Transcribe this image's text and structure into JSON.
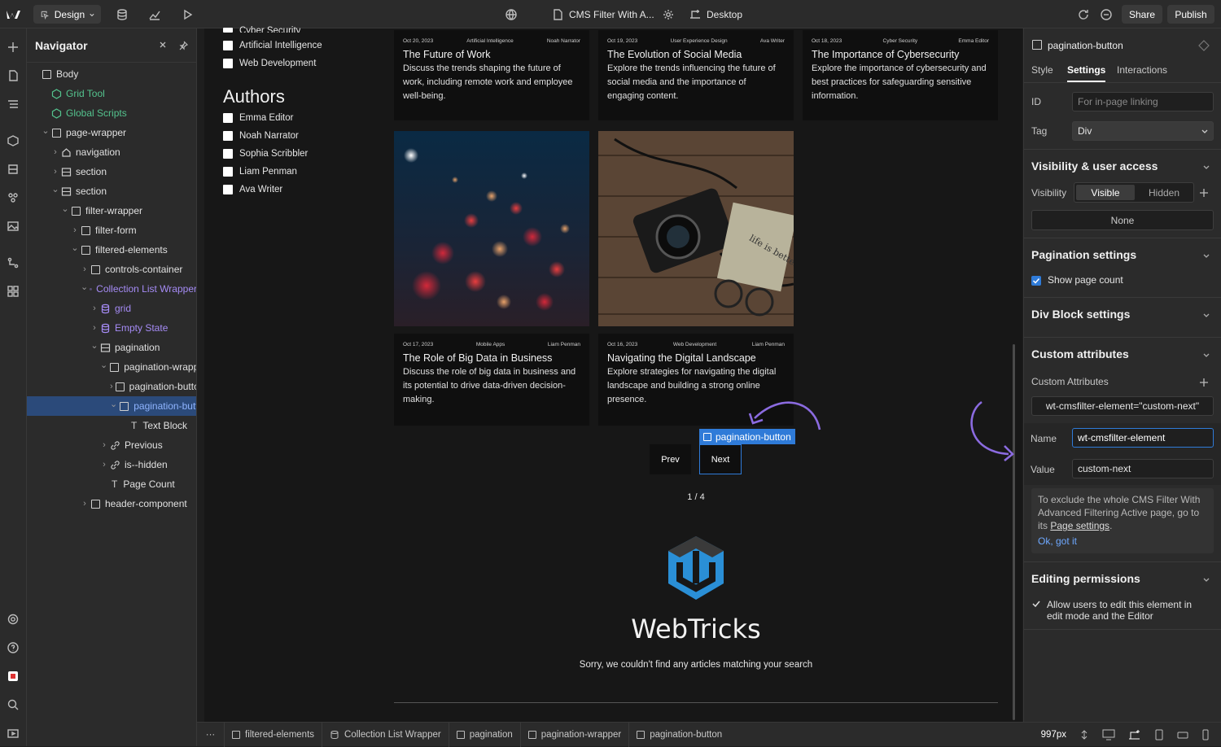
{
  "topbar": {
    "design_label": "Design",
    "page_title": "CMS Filter With A...",
    "breakpoint_label": "Desktop",
    "share_label": "Share",
    "publish_label": "Publish"
  },
  "navigator": {
    "title": "Navigator",
    "tree": [
      {
        "label": "Body",
        "depth": 0,
        "icon": "box",
        "chev": ""
      },
      {
        "label": "Grid Tool",
        "depth": 1,
        "icon": "component",
        "chev": "",
        "color": "green"
      },
      {
        "label": "Global Scripts",
        "depth": 1,
        "icon": "component",
        "chev": "",
        "color": "green"
      },
      {
        "label": "page-wrapper",
        "depth": 1,
        "icon": "box",
        "chev": "v"
      },
      {
        "label": "navigation",
        "depth": 2,
        "icon": "home",
        "chev": ">"
      },
      {
        "label": "section",
        "depth": 2,
        "icon": "section",
        "chev": ">"
      },
      {
        "label": "section",
        "depth": 2,
        "icon": "section",
        "chev": "v"
      },
      {
        "label": "filter-wrapper",
        "depth": 3,
        "icon": "box",
        "chev": "v"
      },
      {
        "label": "filter-form",
        "depth": 4,
        "icon": "box",
        "chev": ">"
      },
      {
        "label": "filtered-elements",
        "depth": 4,
        "icon": "box",
        "chev": "v"
      },
      {
        "label": "controls-container",
        "depth": 5,
        "icon": "box",
        "chev": ">"
      },
      {
        "label": "Collection List Wrapper",
        "depth": 5,
        "icon": "db",
        "chev": "v",
        "color": "purple"
      },
      {
        "label": "grid",
        "depth": 6,
        "icon": "db",
        "chev": ">",
        "color": "purple"
      },
      {
        "label": "Empty State",
        "depth": 6,
        "icon": "db",
        "chev": ">",
        "color": "purple"
      },
      {
        "label": "pagination",
        "depth": 6,
        "icon": "section",
        "chev": "v"
      },
      {
        "label": "pagination-wrapper",
        "depth": 7,
        "icon": "box",
        "chev": "v"
      },
      {
        "label": "pagination-button",
        "depth": 8,
        "icon": "box",
        "chev": ">"
      },
      {
        "label": "pagination-button",
        "depth": 8,
        "icon": "box",
        "chev": "v",
        "selected": true
      },
      {
        "label": "Text Block",
        "depth": 9,
        "icon": "text",
        "chev": ""
      },
      {
        "label": "Previous",
        "depth": 7,
        "icon": "link",
        "chev": ">"
      },
      {
        "label": "is--hidden",
        "depth": 7,
        "icon": "link",
        "chev": ">"
      },
      {
        "label": "Page Count",
        "depth": 7,
        "icon": "text",
        "chev": ""
      },
      {
        "label": "header-component",
        "depth": 5,
        "icon": "box",
        "chev": ">"
      }
    ]
  },
  "canvas": {
    "categories_partial": "Cyber Security",
    "categories": [
      "Artificial Intelligence",
      "Web Development"
    ],
    "authors_heading": "Authors",
    "authors": [
      "Emma Editor",
      "Noah Narrator",
      "Sophia Scribbler",
      "Liam Penman",
      "Ava Writer"
    ],
    "cards_top": [
      {
        "date": "Oct 20, 2023",
        "category": "Artificial Intelligence",
        "author": "Noah Narrator",
        "title": "The Future of Work",
        "desc": "Discuss the trends shaping the future of work, including remote work and employee well-being."
      },
      {
        "date": "Oct 19, 2023",
        "category": "User Experience Design",
        "author": "Ava Writer",
        "title": "The Evolution of Social Media",
        "desc": "Explore the trends influencing the future of social media and the importance of engaging content."
      },
      {
        "date": "Oct 18, 2023",
        "category": "Cyber Security",
        "author": "Emma Editor",
        "title": "The Importance of Cybersecurity",
        "desc": "Explore the importance of cybersecurity and best practices for safeguarding sensitive information."
      }
    ],
    "cards_bottom": [
      {
        "date": "Oct 17, 2023",
        "category": "Mobile Apps",
        "author": "Liam Penman",
        "title": "The Role of Big Data in Business",
        "desc": "Discuss the role of big data in business and its potential to drive data-driven decision-making."
      },
      {
        "date": "Oct 16, 2023",
        "category": "Web Development",
        "author": "Liam Penman",
        "title": "Navigating the Digital Landscape",
        "desc": "Explore strategies for navigating the digital landscape and building a strong online presence."
      }
    ],
    "selected_badge": "pagination-button",
    "prev_label": "Prev",
    "next_label": "Next",
    "page_count": "1 / 4",
    "brand_name": "WebTricks",
    "empty_message": "Sorry, we couldn't find any articles matching your search",
    "photo2_note": "life is better with friends"
  },
  "panel": {
    "element_name": "pagination-button",
    "tabs": [
      "Style",
      "Settings",
      "Interactions"
    ],
    "active_tab": "Settings",
    "id_label": "ID",
    "id_placeholder": "For in-page linking",
    "tag_label": "Tag",
    "tag_value": "Div",
    "visibility_heading": "Visibility & user access",
    "visibility_label": "Visibility",
    "visible_option": "Visible",
    "hidden_option": "Hidden",
    "none_option": "None",
    "pagination_heading": "Pagination settings",
    "show_page_count": "Show page count",
    "show_page_count_checked": true,
    "divblock_heading": "Div Block settings",
    "custom_attrs_heading": "Custom attributes",
    "custom_attrs_label": "Custom Attributes",
    "attr_pill": "wt-cmsfilter-element=\"custom-next\"",
    "name_label": "Name",
    "name_value": "wt-cmsfilter-element",
    "value_label": "Value",
    "value_value": "custom-next",
    "notice_text": "To exclude the whole CMS Filter With Advanced Filtering Active page, go to its",
    "notice_link": "Page settings",
    "notice_dismiss": "Ok, got it",
    "editing_heading": "Editing permissions",
    "editing_text": "Allow users to edit this element in edit mode and the Editor"
  },
  "bottombar": {
    "crumbs": [
      "filtered-elements",
      "Collection List Wrapper",
      "pagination",
      "pagination-wrapper",
      "pagination-button"
    ],
    "width_readout": "997px"
  },
  "colors": {
    "accent": "#2f7bd8",
    "selection": "#2b4a7a",
    "arrow": "#8b6be0",
    "green": "#54c38e",
    "purple": "#a58bf5"
  }
}
